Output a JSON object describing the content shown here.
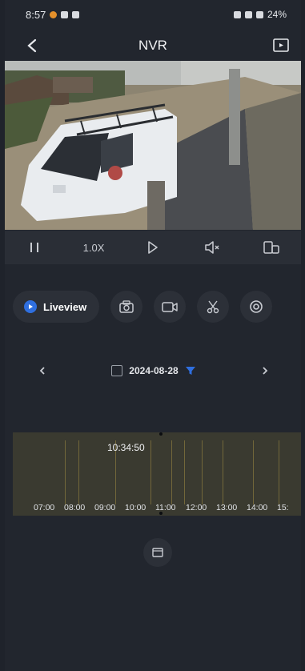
{
  "status": {
    "time": "8:57",
    "battery": "24%"
  },
  "header": {
    "title": "NVR"
  },
  "controls": {
    "zoom_label": "1.0X"
  },
  "actions": {
    "liveview_label": "Liveview"
  },
  "datenav": {
    "date": "2024-08-28"
  },
  "timeline": {
    "current_time": "10:34:50",
    "hours": [
      "07:00",
      "08:00",
      "09:00",
      "10:00",
      "11:00",
      "12:00",
      "13:00",
      "14:00",
      "15:"
    ]
  },
  "colors": {
    "accent": "#2f6fe0",
    "timeline_bg": "#3a3a30",
    "background": "#22262e"
  },
  "icons": [
    "back-arrow-icon",
    "cast-screen-icon",
    "pause-icon",
    "play-step-icon",
    "speaker-mute-icon",
    "device-switch-icon",
    "camera-icon",
    "record-video-icon",
    "scissors-icon",
    "settings-wheel-icon",
    "calendar-icon",
    "filter-icon",
    "chevron-left-icon",
    "chevron-right-icon",
    "image-icon"
  ]
}
